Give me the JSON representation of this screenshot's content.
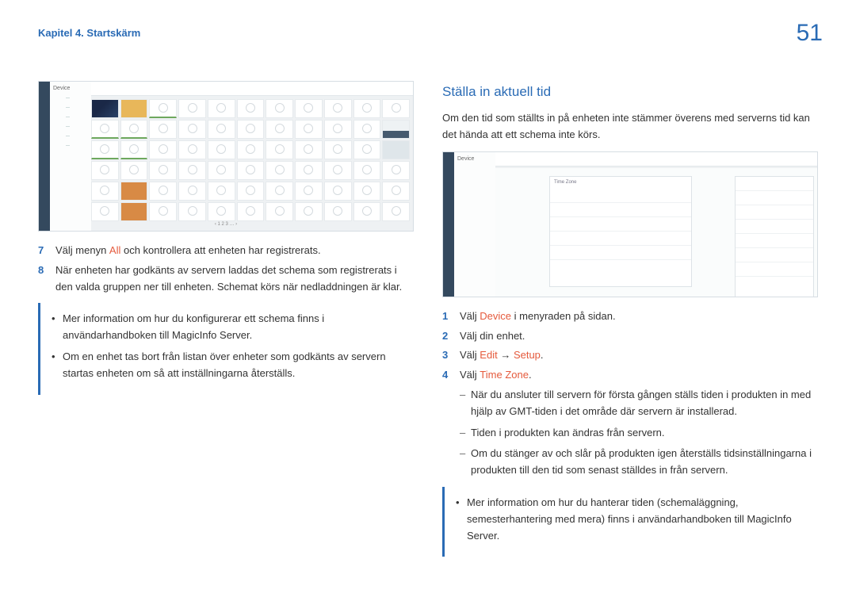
{
  "header": {
    "breadcrumb": "Kapitel 4. Startskärm",
    "page_number": "51"
  },
  "left": {
    "screenshot": {
      "panel_title": "Device",
      "grid_cols": 11,
      "grid_rows": 6
    },
    "steps": [
      {
        "num": "7",
        "pre": "Välj menyn ",
        "hl": "All",
        "post": " och kontrollera att enheten har registrerats."
      },
      {
        "num": "8",
        "pre": "När enheten har godkänts av servern laddas det schema som registrerats i den valda gruppen ner till enheten. Schemat körs när nedladdningen är klar.",
        "hl": "",
        "post": ""
      }
    ],
    "note": [
      "Mer information om hur du konfigurerar ett schema finns i användarhandboken till MagicInfo Server.",
      "Om en enhet tas bort från listan över enheter som godkänts av servern startas enheten om så att inställningarna återställs."
    ]
  },
  "right": {
    "title": "Ställa in aktuell tid",
    "intro": "Om den tid som ställts in på enheten inte stämmer överens med serverns tid kan det hända att ett schema inte körs.",
    "screenshot": {
      "panel_title": "Device",
      "dialog_title": "Time Zone"
    },
    "steps": [
      {
        "num": "1",
        "pre": "Välj ",
        "hl": "Device",
        "post": " i menyraden på sidan."
      },
      {
        "num": "2",
        "pre": "Välj din enhet.",
        "hl": "",
        "post": ""
      },
      {
        "num": "3",
        "pre": "Välj ",
        "hl": "Edit",
        "mid": " → ",
        "hl2": "Setup",
        "post": "."
      },
      {
        "num": "4",
        "pre": "Välj ",
        "hl": "Time Zone",
        "post": "."
      }
    ],
    "sublist": [
      "När du ansluter till servern för första gången ställs tiden i produkten in med hjälp av GMT-tiden i det område där servern är installerad.",
      "Tiden i produkten kan ändras från servern.",
      "Om du stänger av och slår på produkten igen återställs tidsinställningarna i produkten till den tid som senast ställdes in från servern."
    ],
    "note": [
      "Mer information om hur du hanterar tiden (schemaläggning, semesterhantering med mera) finns i användarhandboken till MagicInfo Server."
    ]
  }
}
